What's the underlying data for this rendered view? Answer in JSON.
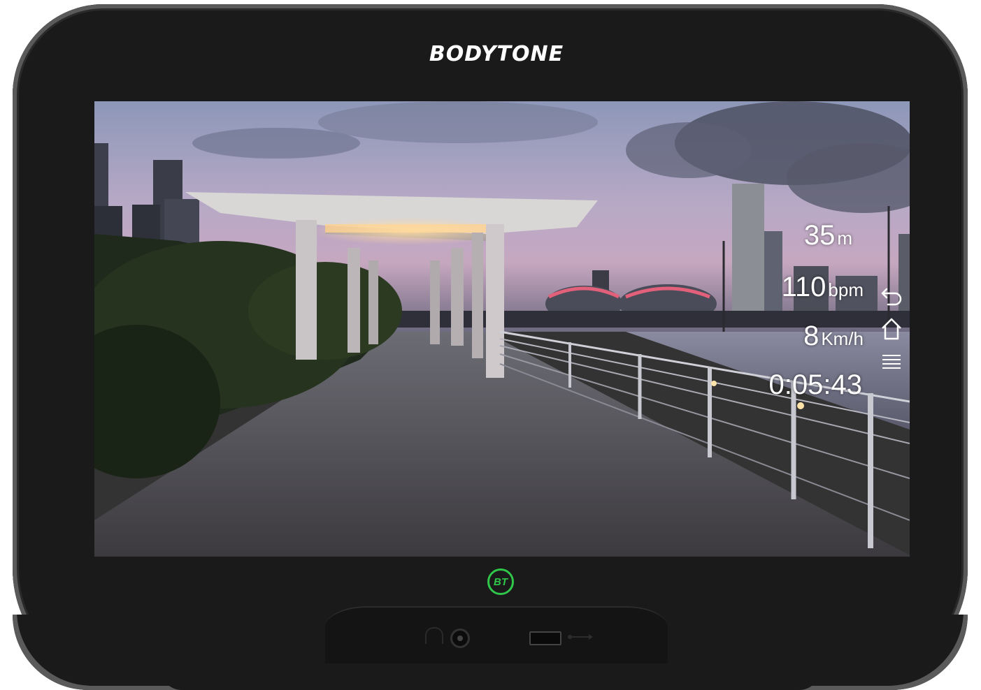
{
  "device": {
    "brand": "BODYTONE",
    "badge": "BT",
    "colors": {
      "bezel": "#1a1a1a",
      "badge": "#2fc64a",
      "text": "#ffffff"
    }
  },
  "screen": {
    "background": "Singapore waterfront promenade at dusk video scene",
    "metrics": {
      "distance": {
        "value": "35",
        "unit": "m"
      },
      "heart_rate": {
        "value": "110",
        "unit": "bpm"
      },
      "speed": {
        "value": "8",
        "unit": "Km/h"
      },
      "time": {
        "value": "0:05:43"
      }
    },
    "controls": [
      {
        "icon": "back-arrow-icon"
      },
      {
        "icon": "home-icon"
      },
      {
        "icon": "menu-icon"
      }
    ]
  },
  "ports": {
    "icons": [
      "headphone-icon",
      "audio-jack",
      "usb-port",
      "usb-icon"
    ]
  }
}
